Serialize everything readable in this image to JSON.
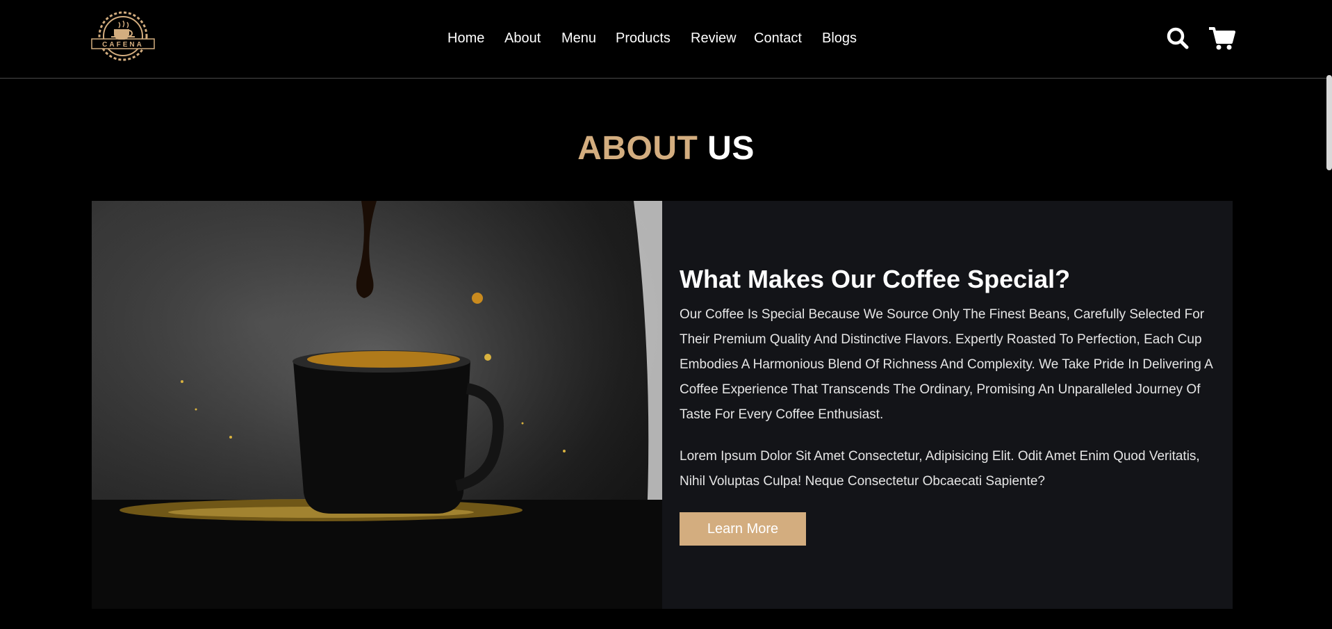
{
  "brand": {
    "logo_text": "CAFENA",
    "accent_color": "#d3ad7f"
  },
  "nav": {
    "items": [
      {
        "label": "Home"
      },
      {
        "label": "About"
      },
      {
        "label": "Menu"
      },
      {
        "label": "Products"
      },
      {
        "label": "Review"
      },
      {
        "label": "Contact"
      },
      {
        "label": "Blogs"
      }
    ]
  },
  "header_icons": {
    "search": "search-icon",
    "cart": "cart-icon"
  },
  "about": {
    "title_accent": "ABOUT",
    "title_rest": "US",
    "heading": "What Makes Our Coffee Special?",
    "paragraph_1": "Our Coffee Is Special Because We Source Only The Finest Beans, Carefully Selected For Their Premium Quality And Distinctive Flavors. Expertly Roasted To Perfection, Each Cup Embodies A Harmonious Blend Of Richness And Complexity. We Take Pride In Delivering A Coffee Experience That Transcends The Ordinary, Promising An Unparalleled Journey Of Taste For Every Coffee Enthusiast.",
    "paragraph_2": "Lorem Ipsum Dolor Sit Amet Consectetur, Adipisicing Elit. Odit Amet Enim Quod Veritatis, Nihil Voluptas Culpa! Neque Consectetur Obcaecati Sapiente?",
    "button_label": "Learn More"
  }
}
